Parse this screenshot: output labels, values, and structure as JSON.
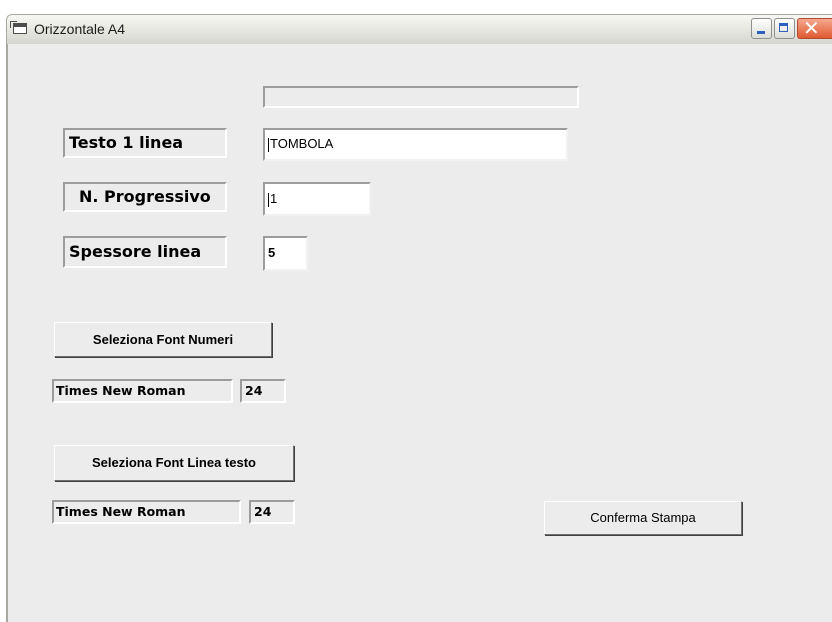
{
  "window": {
    "title": "Orizzontale A4"
  },
  "form": {
    "text_line": {
      "label": "Testo 1 linea",
      "value": "TOMBOLA"
    },
    "progressive": {
      "label": "N. Progressivo",
      "value": "1"
    },
    "line_thickness": {
      "label": "Spessore linea",
      "value": "5"
    }
  },
  "font_numbers": {
    "button_label": "Seleziona Font Numeri",
    "font_name": "Times New Roman",
    "font_size": "24"
  },
  "font_text": {
    "button_label": "Seleziona Font Linea testo",
    "font_name": "Times New Roman",
    "font_size": "24"
  },
  "confirm_label": "Conferma Stampa"
}
